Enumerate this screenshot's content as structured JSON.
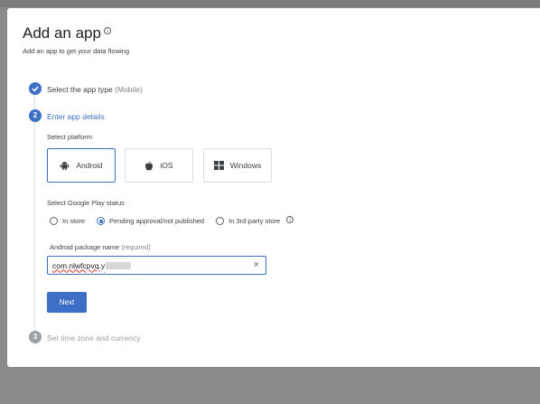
{
  "dialog": {
    "title": "Add an app",
    "subtitle": "Add an app to get your data flowing"
  },
  "steps": [
    {
      "number": "✓",
      "label": "Select the app type",
      "detail": "(Mobile)",
      "state": "complete"
    },
    {
      "number": "2",
      "label": "Enter app details",
      "state": "active"
    },
    {
      "number": "3",
      "label": "Set time zone and currency",
      "state": "pending"
    }
  ],
  "platform": {
    "label": "Select platform",
    "options": [
      {
        "label": "Android",
        "icon": "android-icon",
        "selected": true
      },
      {
        "label": "iOS",
        "icon": "apple-icon",
        "selected": false
      },
      {
        "label": "Windows",
        "icon": "windows-icon",
        "selected": false
      }
    ]
  },
  "play_status": {
    "label": "Select Google Play status",
    "options": [
      {
        "label": "In store",
        "selected": false
      },
      {
        "label": "Pending approval/not published",
        "selected": true
      },
      {
        "label": "In 3rd-party store",
        "selected": false
      }
    ]
  },
  "package": {
    "label": "Android package name",
    "required": "(required)",
    "value": "com.nlwfcpvq.y"
  },
  "next_label": "Next",
  "colors": {
    "accent": "#3c6fc5",
    "overlay": "#8a8a8a"
  }
}
